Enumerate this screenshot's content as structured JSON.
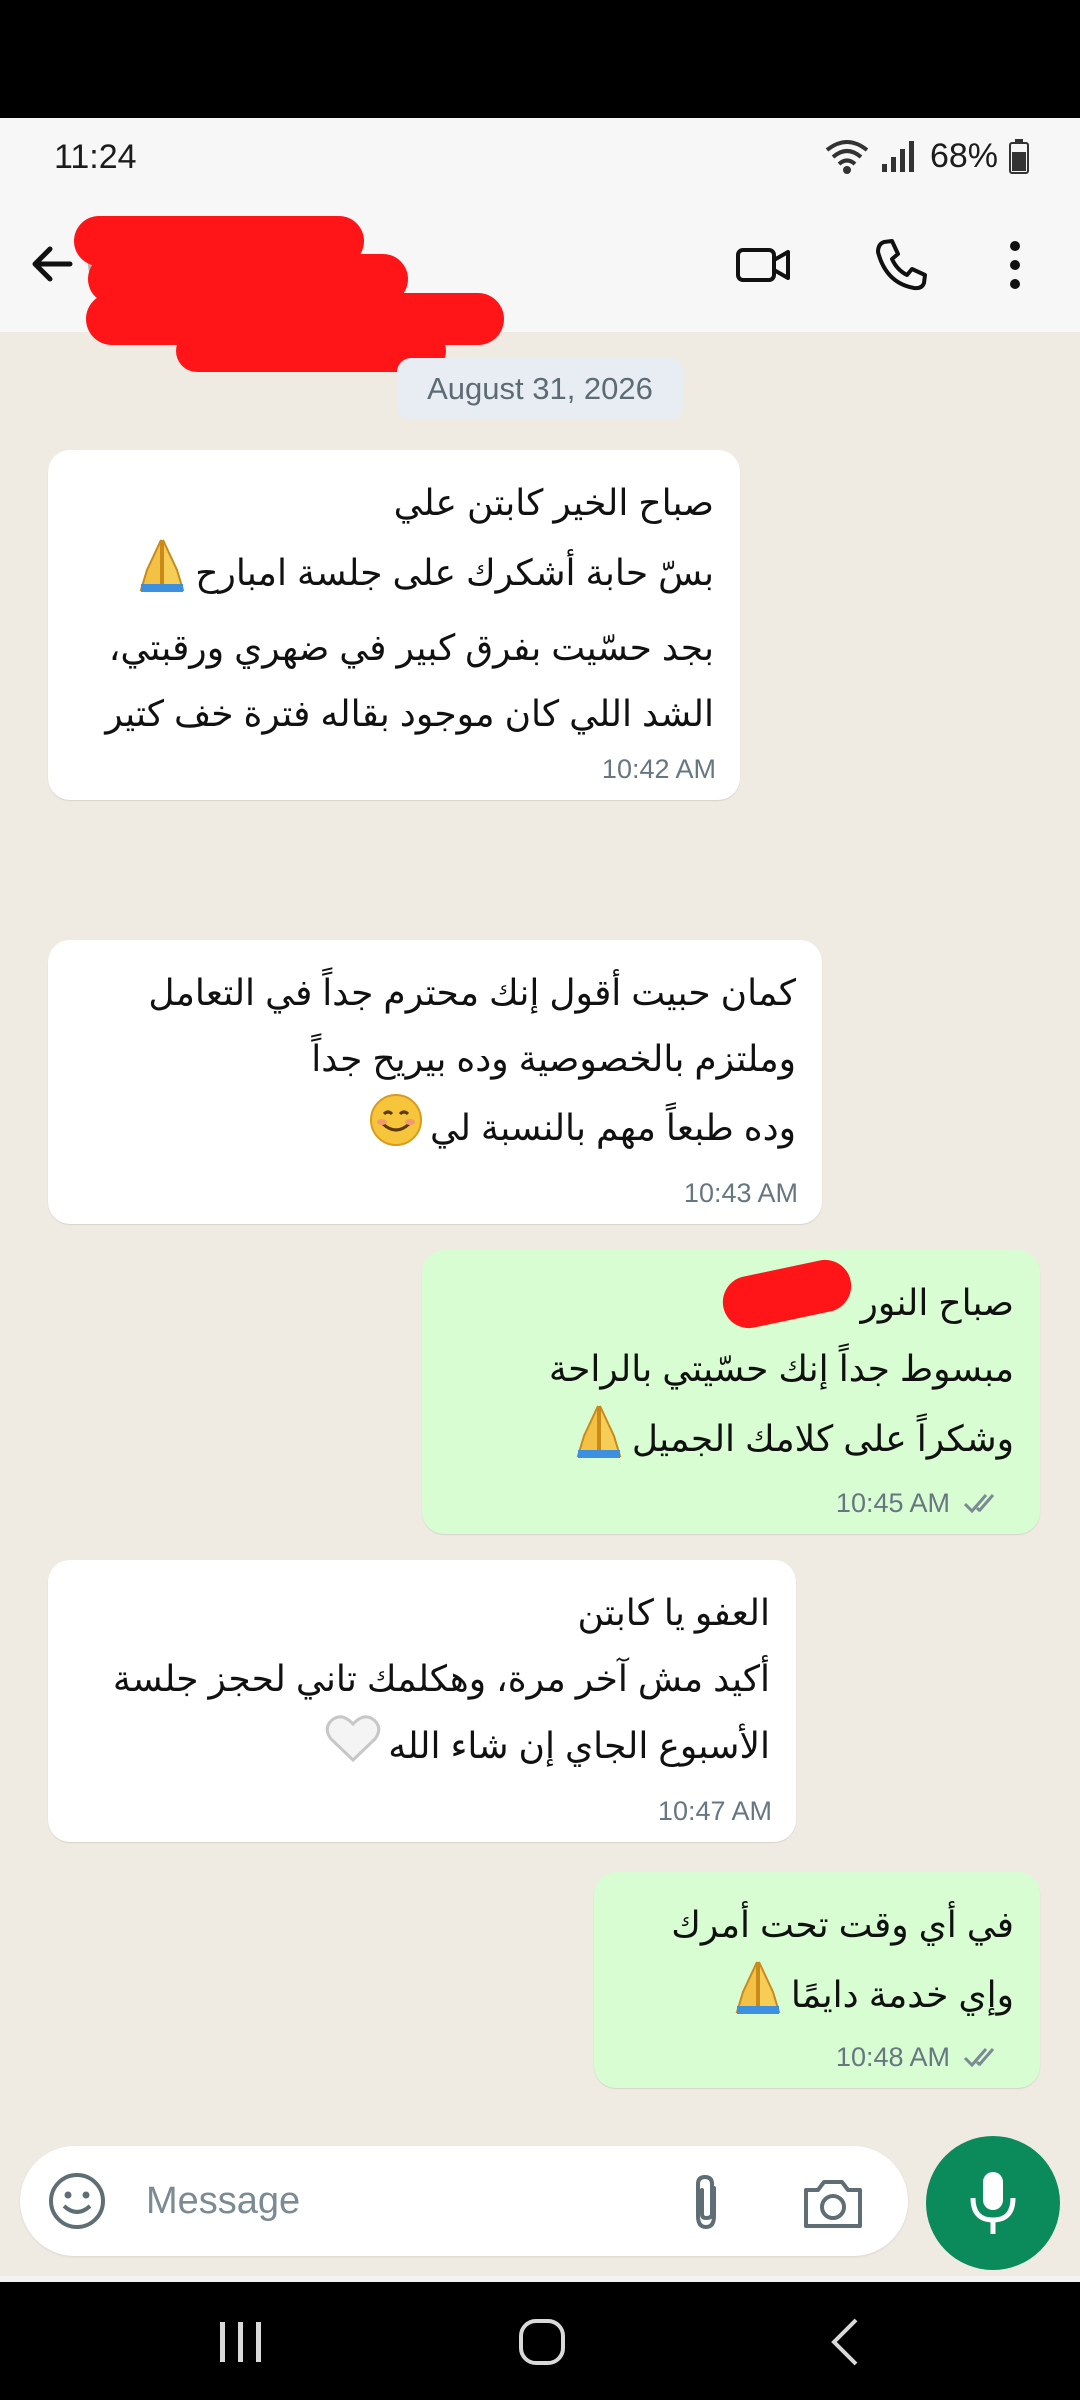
{
  "status": {
    "time": "11:24",
    "battery": "68%"
  },
  "header": {
    "contact_name": ""
  },
  "date_chip": "August 31, 2026",
  "messages": [
    {
      "dir": "in",
      "lines": [
        "صباح الخير كابتن علي",
        "بسّ حابة أشكرك على جلسة امبارح",
        "بجد حسّيت بفرق كبير في ضهري ورقبتي،",
        "الشد اللي كان موجود بقاله فترة خف كتير"
      ],
      "time": "10:42 AM"
    },
    {
      "dir": "in",
      "lines": [
        "كمان حبيت أقول إنك محترم جداً في التعامل",
        "وملتزم بالخصوصية وده بيريح جداً",
        "وده طبعاً مهم بالنسبة لي"
      ],
      "time": "10:43 AM"
    },
    {
      "dir": "out",
      "lines": [
        "صباح النور",
        "مبسوط جداً إنك حسّيتي بالراحة",
        "وشكراً على كلامك الجميل"
      ],
      "time": "10:45 AM"
    },
    {
      "dir": "in",
      "lines": [
        "العفو يا كابتن",
        "أكيد مش آخر مرة، وهكلمك تاني لحجز جلسة",
        "الأسبوع الجاي إن شاء الله"
      ],
      "time": "10:47 AM"
    },
    {
      "dir": "out",
      "lines": [
        "في أي وقت تحت أمرك",
        "وإي خدمة دايمًا"
      ],
      "time": "10:48 AM"
    }
  ],
  "composer": {
    "placeholder": "Message"
  },
  "colors": {
    "chat_bg": "#efeae2",
    "incoming": "#ffffff",
    "outgoing": "#d9fdd3",
    "mic": "#0b8a5c",
    "redaction": "#ff1418"
  }
}
